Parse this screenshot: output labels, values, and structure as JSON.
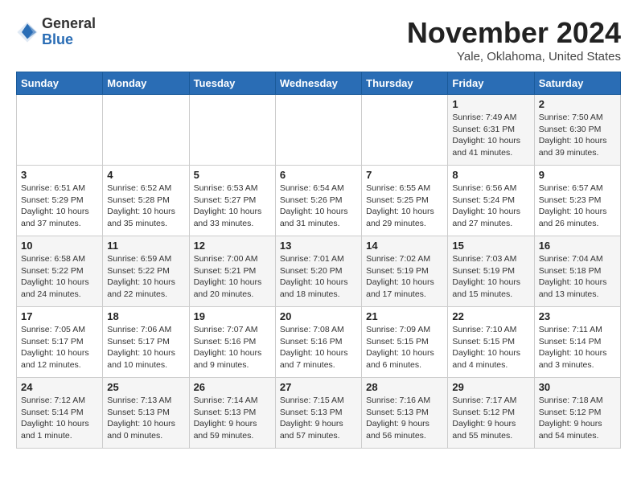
{
  "header": {
    "logo_general": "General",
    "logo_blue": "Blue",
    "month_title": "November 2024",
    "location": "Yale, Oklahoma, United States"
  },
  "weekdays": [
    "Sunday",
    "Monday",
    "Tuesday",
    "Wednesday",
    "Thursday",
    "Friday",
    "Saturday"
  ],
  "weeks": [
    [
      {
        "day": "",
        "info": ""
      },
      {
        "day": "",
        "info": ""
      },
      {
        "day": "",
        "info": ""
      },
      {
        "day": "",
        "info": ""
      },
      {
        "day": "",
        "info": ""
      },
      {
        "day": "1",
        "info": "Sunrise: 7:49 AM\nSunset: 6:31 PM\nDaylight: 10 hours and 41 minutes."
      },
      {
        "day": "2",
        "info": "Sunrise: 7:50 AM\nSunset: 6:30 PM\nDaylight: 10 hours and 39 minutes."
      }
    ],
    [
      {
        "day": "3",
        "info": "Sunrise: 6:51 AM\nSunset: 5:29 PM\nDaylight: 10 hours and 37 minutes."
      },
      {
        "day": "4",
        "info": "Sunrise: 6:52 AM\nSunset: 5:28 PM\nDaylight: 10 hours and 35 minutes."
      },
      {
        "day": "5",
        "info": "Sunrise: 6:53 AM\nSunset: 5:27 PM\nDaylight: 10 hours and 33 minutes."
      },
      {
        "day": "6",
        "info": "Sunrise: 6:54 AM\nSunset: 5:26 PM\nDaylight: 10 hours and 31 minutes."
      },
      {
        "day": "7",
        "info": "Sunrise: 6:55 AM\nSunset: 5:25 PM\nDaylight: 10 hours and 29 minutes."
      },
      {
        "day": "8",
        "info": "Sunrise: 6:56 AM\nSunset: 5:24 PM\nDaylight: 10 hours and 27 minutes."
      },
      {
        "day": "9",
        "info": "Sunrise: 6:57 AM\nSunset: 5:23 PM\nDaylight: 10 hours and 26 minutes."
      }
    ],
    [
      {
        "day": "10",
        "info": "Sunrise: 6:58 AM\nSunset: 5:22 PM\nDaylight: 10 hours and 24 minutes."
      },
      {
        "day": "11",
        "info": "Sunrise: 6:59 AM\nSunset: 5:22 PM\nDaylight: 10 hours and 22 minutes."
      },
      {
        "day": "12",
        "info": "Sunrise: 7:00 AM\nSunset: 5:21 PM\nDaylight: 10 hours and 20 minutes."
      },
      {
        "day": "13",
        "info": "Sunrise: 7:01 AM\nSunset: 5:20 PM\nDaylight: 10 hours and 18 minutes."
      },
      {
        "day": "14",
        "info": "Sunrise: 7:02 AM\nSunset: 5:19 PM\nDaylight: 10 hours and 17 minutes."
      },
      {
        "day": "15",
        "info": "Sunrise: 7:03 AM\nSunset: 5:19 PM\nDaylight: 10 hours and 15 minutes."
      },
      {
        "day": "16",
        "info": "Sunrise: 7:04 AM\nSunset: 5:18 PM\nDaylight: 10 hours and 13 minutes."
      }
    ],
    [
      {
        "day": "17",
        "info": "Sunrise: 7:05 AM\nSunset: 5:17 PM\nDaylight: 10 hours and 12 minutes."
      },
      {
        "day": "18",
        "info": "Sunrise: 7:06 AM\nSunset: 5:17 PM\nDaylight: 10 hours and 10 minutes."
      },
      {
        "day": "19",
        "info": "Sunrise: 7:07 AM\nSunset: 5:16 PM\nDaylight: 10 hours and 9 minutes."
      },
      {
        "day": "20",
        "info": "Sunrise: 7:08 AM\nSunset: 5:16 PM\nDaylight: 10 hours and 7 minutes."
      },
      {
        "day": "21",
        "info": "Sunrise: 7:09 AM\nSunset: 5:15 PM\nDaylight: 10 hours and 6 minutes."
      },
      {
        "day": "22",
        "info": "Sunrise: 7:10 AM\nSunset: 5:15 PM\nDaylight: 10 hours and 4 minutes."
      },
      {
        "day": "23",
        "info": "Sunrise: 7:11 AM\nSunset: 5:14 PM\nDaylight: 10 hours and 3 minutes."
      }
    ],
    [
      {
        "day": "24",
        "info": "Sunrise: 7:12 AM\nSunset: 5:14 PM\nDaylight: 10 hours and 1 minute."
      },
      {
        "day": "25",
        "info": "Sunrise: 7:13 AM\nSunset: 5:13 PM\nDaylight: 10 hours and 0 minutes."
      },
      {
        "day": "26",
        "info": "Sunrise: 7:14 AM\nSunset: 5:13 PM\nDaylight: 9 hours and 59 minutes."
      },
      {
        "day": "27",
        "info": "Sunrise: 7:15 AM\nSunset: 5:13 PM\nDaylight: 9 hours and 57 minutes."
      },
      {
        "day": "28",
        "info": "Sunrise: 7:16 AM\nSunset: 5:13 PM\nDaylight: 9 hours and 56 minutes."
      },
      {
        "day": "29",
        "info": "Sunrise: 7:17 AM\nSunset: 5:12 PM\nDaylight: 9 hours and 55 minutes."
      },
      {
        "day": "30",
        "info": "Sunrise: 7:18 AM\nSunset: 5:12 PM\nDaylight: 9 hours and 54 minutes."
      }
    ]
  ]
}
